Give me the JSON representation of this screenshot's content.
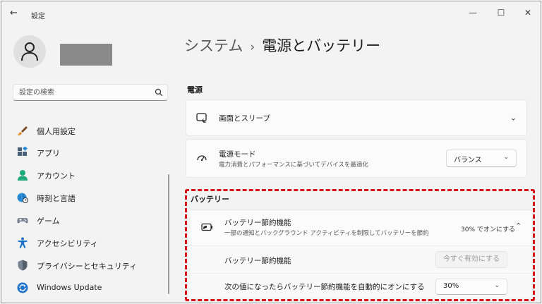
{
  "window": {
    "title": "設定",
    "back_glyph": "←",
    "minimize_glyph": "—",
    "maximize_glyph": "☐",
    "close_glyph": "✕"
  },
  "search": {
    "placeholder": "設定の検索"
  },
  "sidebar": {
    "items": [
      {
        "label": "個人用設定",
        "icon": "paintbrush-icon"
      },
      {
        "label": "アプリ",
        "icon": "apps-icon"
      },
      {
        "label": "アカウント",
        "icon": "account-icon"
      },
      {
        "label": "時刻と言語",
        "icon": "globe-clock-icon"
      },
      {
        "label": "ゲーム",
        "icon": "gamepad-icon"
      },
      {
        "label": "アクセシビリティ",
        "icon": "accessibility-icon"
      },
      {
        "label": "プライバシーとセキュリティ",
        "icon": "shield-icon"
      },
      {
        "label": "Windows Update",
        "icon": "windows-update-icon"
      }
    ]
  },
  "breadcrumb": {
    "parent": "システム",
    "separator": "›",
    "current": "電源とバッテリー"
  },
  "power": {
    "section_label": "電源",
    "screen_sleep": {
      "title": "画面とスリープ"
    },
    "power_mode": {
      "title": "電源モード",
      "description": "電力消費とパフォーマンスに基づいてデバイスを最適化",
      "value": "バランス"
    }
  },
  "battery": {
    "section_label": "バッテリー",
    "saver": {
      "title": "バッテリー節約機能",
      "description": "一部の通知とバックグラウンド アクティビティを制限してバッテリーを節約",
      "status": "30% でオンにする"
    },
    "saver_toggle": {
      "label": "バッテリー節約機能",
      "button": "今すぐ有効にする"
    },
    "auto_on": {
      "label": "次の値になったらバッテリー節約機能を自動的にオンにする",
      "value": "30%"
    }
  },
  "colors": {
    "highlight": "#d7141a",
    "accent": "#0067c0"
  }
}
